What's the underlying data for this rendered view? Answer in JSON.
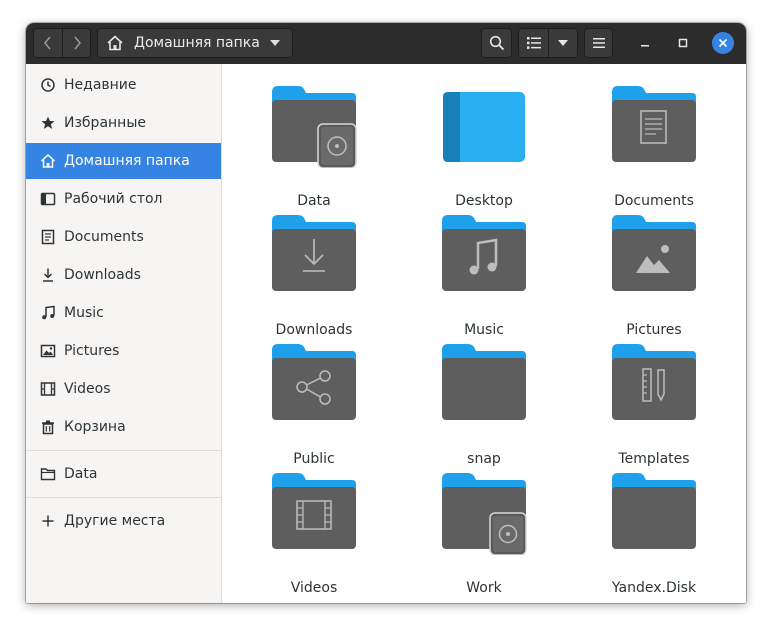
{
  "header": {
    "back_icon": "chevron-left-icon",
    "forward_icon": "chevron-right-icon",
    "location_icon": "home-icon",
    "location_label": "Домашняя папка",
    "search_icon": "search-icon",
    "view_icon": "list-view-icon",
    "view_menu_icon": "chevron-down-icon",
    "menu_icon": "hamburger-icon",
    "minimize_icon": "minimize-icon",
    "maximize_icon": "maximize-icon",
    "close_icon": "close-icon"
  },
  "sidebar": {
    "items": [
      {
        "label": "Недавние",
        "icon": "clock-icon"
      },
      {
        "label": "Избранные",
        "icon": "star-icon"
      },
      {
        "label": "Домашняя папка",
        "icon": "home-icon",
        "active": true
      },
      {
        "label": "Рабочий стол",
        "icon": "desktop-icon"
      },
      {
        "label": "Documents",
        "icon": "document-icon"
      },
      {
        "label": "Downloads",
        "icon": "download-icon"
      },
      {
        "label": "Music",
        "icon": "music-icon"
      },
      {
        "label": "Pictures",
        "icon": "picture-icon"
      },
      {
        "label": "Videos",
        "icon": "film-icon"
      },
      {
        "label": "Корзина",
        "icon": "trash-icon"
      }
    ],
    "drives": [
      {
        "label": "Data",
        "icon": "folder-outline-icon"
      }
    ],
    "other": [
      {
        "label": "Другие места",
        "icon": "plus-icon"
      }
    ]
  },
  "files": [
    {
      "label": "Data",
      "icon": "folder-drive-icon"
    },
    {
      "label": "Desktop",
      "icon": "folder-desktop-icon"
    },
    {
      "label": "Documents",
      "icon": "folder-documents-icon"
    },
    {
      "label": "Downloads",
      "icon": "folder-downloads-icon"
    },
    {
      "label": "Music",
      "icon": "folder-music-icon"
    },
    {
      "label": "Pictures",
      "icon": "folder-pictures-icon"
    },
    {
      "label": "Public",
      "icon": "folder-share-icon"
    },
    {
      "label": "snap",
      "icon": "folder-icon"
    },
    {
      "label": "Templates",
      "icon": "folder-templates-icon"
    },
    {
      "label": "Videos",
      "icon": "folder-videos-icon"
    },
    {
      "label": "Work",
      "icon": "folder-drive-icon"
    },
    {
      "label": "Yandex.Disk",
      "icon": "folder-icon"
    }
  ],
  "colors": {
    "accent": "#3584e4",
    "folder_tab": "#1ea1ea",
    "folder_body": "#5e5e5e",
    "header_bg": "#2c2c2c",
    "sidebar_bg": "#f6f5f4"
  }
}
